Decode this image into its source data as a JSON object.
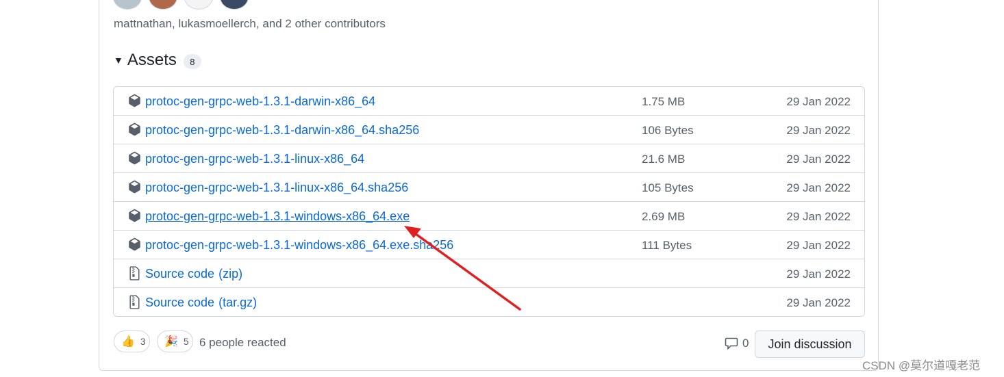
{
  "contributors": {
    "text": "mattnathan, lukasmoellerch, and 2 other contributors"
  },
  "assets": {
    "title": "Assets",
    "count": "8",
    "items": [
      {
        "name": "protoc-gen-grpc-web-1.3.1-darwin-x86_64",
        "size": "1.75 MB",
        "date": "29 Jan 2022",
        "icon": "package-icon"
      },
      {
        "name": "protoc-gen-grpc-web-1.3.1-darwin-x86_64.sha256",
        "size": "106 Bytes",
        "date": "29 Jan 2022",
        "icon": "package-icon"
      },
      {
        "name": "protoc-gen-grpc-web-1.3.1-linux-x86_64",
        "size": "21.6 MB",
        "date": "29 Jan 2022",
        "icon": "package-icon"
      },
      {
        "name": "protoc-gen-grpc-web-1.3.1-linux-x86_64.sha256",
        "size": "105 Bytes",
        "date": "29 Jan 2022",
        "icon": "package-icon"
      },
      {
        "name": "protoc-gen-grpc-web-1.3.1-windows-x86_64.exe",
        "size": "2.69 MB",
        "date": "29 Jan 2022",
        "icon": "package-icon"
      },
      {
        "name": "protoc-gen-grpc-web-1.3.1-windows-x86_64.exe.sha256",
        "size": "111 Bytes",
        "date": "29 Jan 2022",
        "icon": "package-icon"
      },
      {
        "name": "Source code",
        "suffix": "(zip)",
        "date": "29 Jan 2022",
        "icon": "file-zip-icon"
      },
      {
        "name": "Source code",
        "suffix": "(tar.gz)",
        "date": "29 Jan 2022",
        "icon": "file-zip-icon"
      }
    ]
  },
  "reactions": {
    "thumbs_up_count": "3",
    "tada_count": "5",
    "summary": "6 people reacted"
  },
  "discussion": {
    "comment_count": "0",
    "join_label": "Join discussion"
  },
  "watermark": "CSDN @莫尔道嘎老范",
  "colors": {
    "link": "#0969da",
    "muted": "#57606a",
    "border": "#d0d7de",
    "arrow": "#e02020"
  }
}
